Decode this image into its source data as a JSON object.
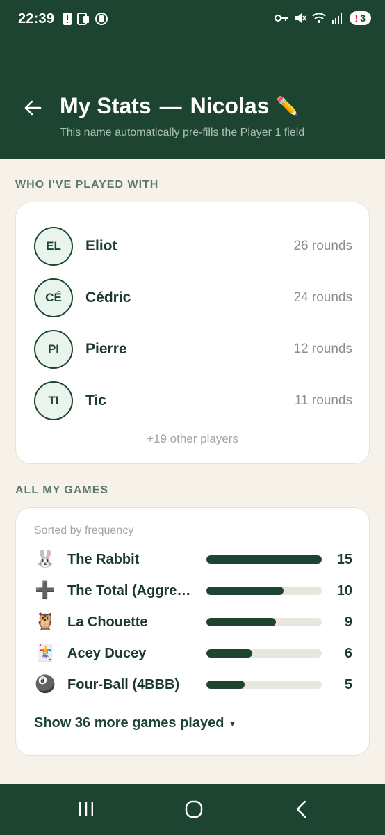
{
  "status_bar": {
    "time": "22:39",
    "notification_count": "3"
  },
  "header": {
    "title": "My Stats",
    "separator": "—",
    "player_name": "Nicolas",
    "subtitle": "This name automatically pre-fills the Player 1 field"
  },
  "played_with": {
    "section_label": "WHO I'VE PLAYED WITH",
    "players": [
      {
        "initials": "EL",
        "name": "Eliot",
        "rounds": "26 rounds"
      },
      {
        "initials": "CÉ",
        "name": "Cédric",
        "rounds": "24 rounds"
      },
      {
        "initials": "PI",
        "name": "Pierre",
        "rounds": "12 rounds"
      },
      {
        "initials": "TI",
        "name": "Tic",
        "rounds": "11 rounds"
      }
    ],
    "other_players": "+19 other players"
  },
  "games": {
    "section_label": "ALL MY GAMES",
    "sorted_label": "Sorted by frequency",
    "items": [
      {
        "icon": "🐰",
        "icon_name": "rabbit-icon",
        "name": "The Rabbit",
        "count": "15",
        "fraction": 1.0
      },
      {
        "icon": "➕",
        "icon_name": "plus-icon",
        "name": "The Total (Aggregate)",
        "count": "10",
        "fraction": 0.667
      },
      {
        "icon": "🦉",
        "icon_name": "owl-icon",
        "name": "La Chouette",
        "count": "9",
        "fraction": 0.6
      },
      {
        "icon": "🃏",
        "icon_name": "joker-card-icon",
        "name": "Acey Ducey",
        "count": "6",
        "fraction": 0.4
      },
      {
        "icon": "🎱",
        "icon_name": "eight-ball-icon",
        "name": "Four-Ball (4BBB)",
        "count": "5",
        "fraction": 0.333
      }
    ],
    "show_more": "Show 36 more games played"
  },
  "colors": {
    "brand": "#1c4431",
    "background": "#f6f2ea"
  }
}
